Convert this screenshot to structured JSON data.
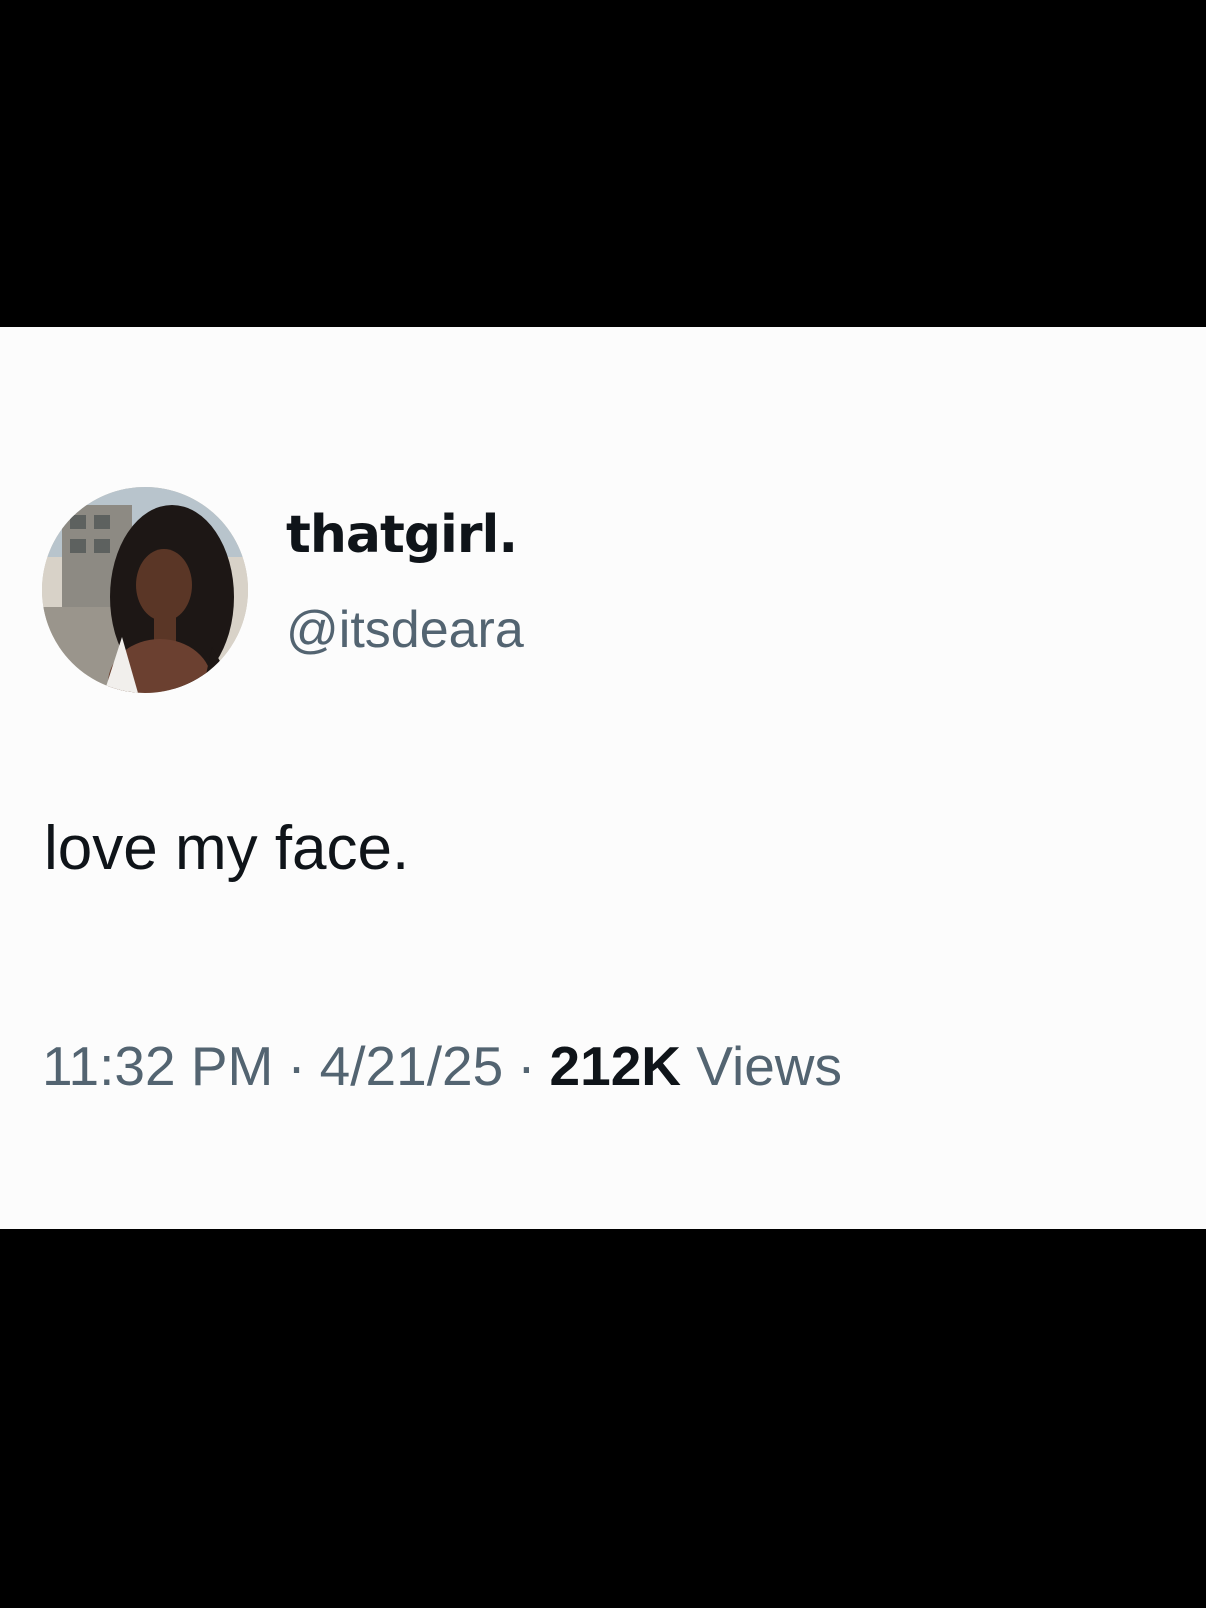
{
  "colors": {
    "letterbox": "#000000",
    "card_background": "#fcfcfc",
    "primary_text": "#0f1419",
    "secondary_text": "#536471"
  },
  "profile": {
    "display_name": "thatgirl.",
    "handle": "@itsdeara",
    "avatar_icon": "profile-photo"
  },
  "tweet": {
    "text": "love my face."
  },
  "meta": {
    "time": "11:32 PM",
    "separator": "·",
    "date": "4/21/25",
    "views_count": "212K",
    "views_label": "Views"
  }
}
